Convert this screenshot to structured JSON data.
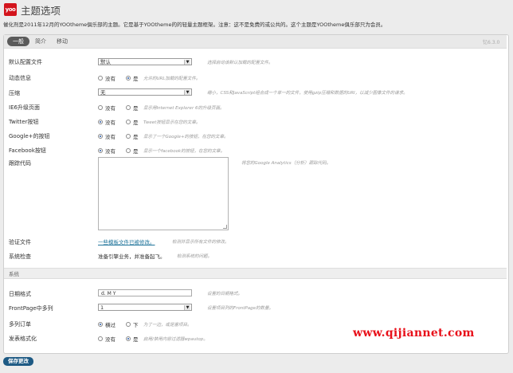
{
  "header": {
    "logo_text": "yoo",
    "title": "主题选项"
  },
  "intro_text": "催化剂是2011年12月的YOOtheme俱乐部的主题。它是基于YOOtheme的的轻量主题框架。注意：这不是免费的或公共的。这个主题是YOOtheme俱乐部只为会员。",
  "tabs": [
    {
      "label": "一般",
      "active": true
    },
    {
      "label": "简介",
      "active": false
    },
    {
      "label": "移动",
      "active": false
    }
  ],
  "version": "钇6.3.0",
  "general": {
    "default_profile": {
      "label": "默认配置文件",
      "value": "默认",
      "help": "选择启动该默认加载的配置文件。"
    },
    "dynamic_style": {
      "label": "动态信息",
      "options": [
        "没有",
        "是"
      ],
      "selected": "是",
      "help": "允许的URL加载的配置文件。"
    },
    "compression": {
      "label": "压缩",
      "value": "无",
      "help": "缩小，CSS和JavaScript组合成一个单一的文件，使用gzip压缩和数据的URI，以减少图像文件的请求。"
    },
    "ie6_page": {
      "label": "IE6升级页面",
      "options": [
        "没有",
        "是"
      ],
      "selected": "没有",
      "help": "显示用Internet Explorer 6的升级页面。"
    },
    "twitter_button": {
      "label": "Twitter按钮",
      "options": [
        "没有",
        "是"
      ],
      "selected": "没有",
      "help": "Tweet按钮显示在您的文章。"
    },
    "googleplus_button": {
      "label": "Google+的按钮",
      "options": [
        "没有",
        "是"
      ],
      "selected": "没有",
      "help": "显示了一个Google+的按钮，在您的文章。"
    },
    "facebook_button": {
      "label": "Facebook按钮",
      "options": [
        "没有",
        "是"
      ],
      "selected": "没有",
      "help": "显示一个facebook的按钮，在您的文章。"
    },
    "tracking_code": {
      "label": "跟踪代码",
      "value": "",
      "help": "将您的Google Analytics（分析）跟踪代码。"
    },
    "verify_files": {
      "label": "验证文件",
      "link": "一些模板文件已被修改。",
      "help": "检测并显示所有文件的修改。"
    },
    "system_check": {
      "label": "系统检查",
      "value": "准备引擎业务，并准备起飞。",
      "help": "检测系统的问题。"
    }
  },
  "system": {
    "section_label": "系统",
    "date_format": {
      "label": "日期格式",
      "value": "d. M Y",
      "help": "设置的日期格式。"
    },
    "frontpage_columns": {
      "label": "FrontPage中多列",
      "value": "1",
      "help": "设置项目列的FrontPage的数量。"
    },
    "multiple_order": {
      "label": "多列订单",
      "options": [
        "横过",
        "下"
      ],
      "selected": "横过",
      "help": "为了一边，或是塞项目。"
    },
    "post_format": {
      "label": "发表格式化",
      "options": [
        "没有",
        "是"
      ],
      "selected": "是",
      "help": "启用/禁用内容过滤器wpautop。"
    }
  },
  "watermark": "www.qijiannet.com",
  "save_label": "保存更改",
  "colors": {
    "brand": "#d3141c",
    "save": "#1e5a84",
    "watermark": "#e8101a",
    "link": "#21759b"
  }
}
